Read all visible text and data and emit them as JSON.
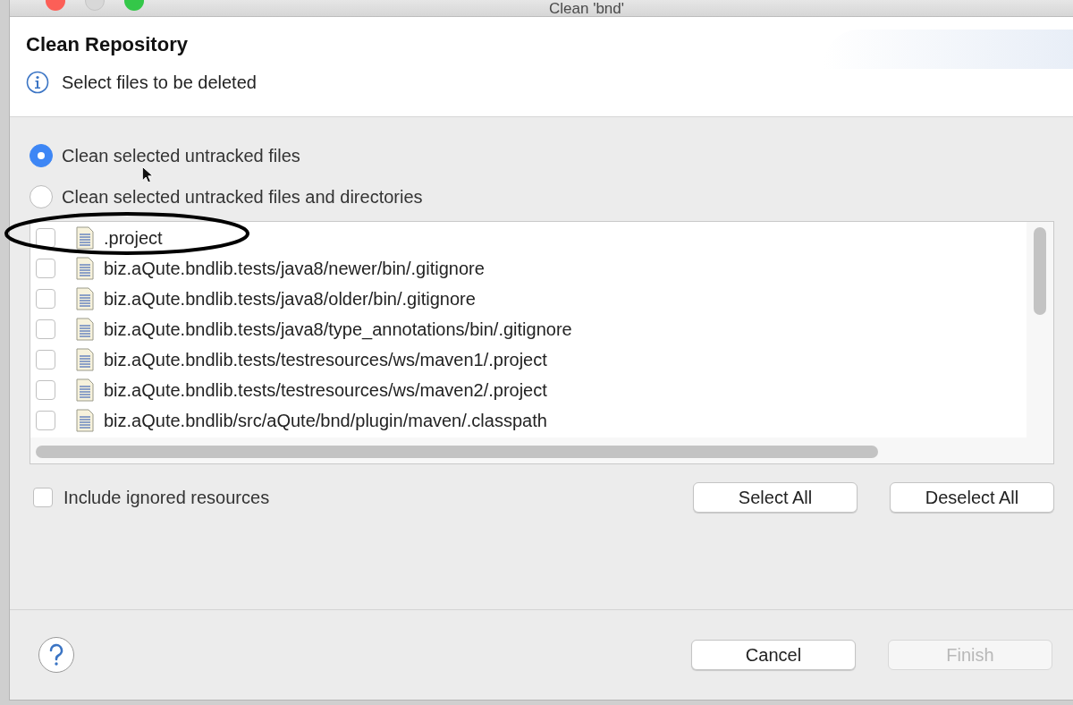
{
  "window": {
    "title": "Clean 'bnd'"
  },
  "header": {
    "title": "Clean Repository",
    "message": "Select files to be deleted"
  },
  "options": [
    {
      "label": "Clean selected untracked files",
      "selected": true
    },
    {
      "label": "Clean selected untracked files and directories",
      "selected": false
    }
  ],
  "files": [
    {
      "name": ".project",
      "checked": false
    },
    {
      "name": "biz.aQute.bndlib.tests/java8/newer/bin/.gitignore",
      "checked": false
    },
    {
      "name": "biz.aQute.bndlib.tests/java8/older/bin/.gitignore",
      "checked": false
    },
    {
      "name": "biz.aQute.bndlib.tests/java8/type_annotations/bin/.gitignore",
      "checked": false
    },
    {
      "name": "biz.aQute.bndlib.tests/testresources/ws/maven1/.project",
      "checked": false
    },
    {
      "name": "biz.aQute.bndlib.tests/testresources/ws/maven2/.project",
      "checked": false
    },
    {
      "name": "biz.aQute.bndlib/src/aQute/bnd/plugin/maven/.classpath",
      "checked": false
    }
  ],
  "include_ignored": {
    "label": "Include ignored resources",
    "checked": false
  },
  "list_buttons": [
    {
      "label": "Select All"
    },
    {
      "label": "Deselect All"
    }
  ],
  "footer_buttons": [
    {
      "label": "Cancel",
      "disabled": false
    },
    {
      "label": "Finish",
      "disabled": true
    }
  ]
}
